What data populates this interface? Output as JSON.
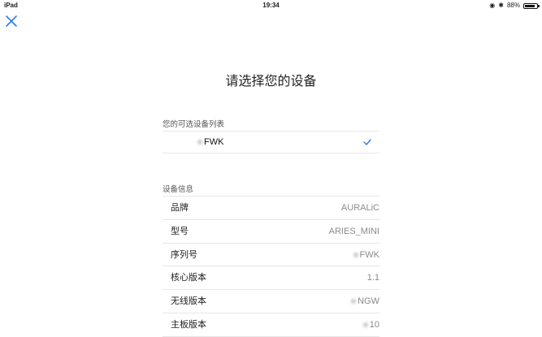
{
  "status_bar": {
    "device": "iPad",
    "time": "19:34",
    "battery_text": "88%",
    "battery_level": 0.88
  },
  "header": {
    "close_icon": "close-icon",
    "title": "请选择您的设备"
  },
  "device_list": {
    "section_label": "您的可选设备列表",
    "items": [
      {
        "name": "FWK",
        "selected": true
      }
    ]
  },
  "device_info": {
    "section_label": "设备信息",
    "rows": [
      {
        "label": "品牌",
        "value": "AURALiC"
      },
      {
        "label": "型号",
        "value": "ARIES_MINI"
      },
      {
        "label": "序列号",
        "value": "FWK"
      },
      {
        "label": "核心版本",
        "value": "1.1"
      },
      {
        "label": "无线版本",
        "value": "NGW"
      },
      {
        "label": "主板版本",
        "value": "10"
      }
    ]
  },
  "colors": {
    "accent": "#2b7de9",
    "text": "#222222",
    "secondary_text": "#8a8a8a",
    "divider": "#e6e6e6"
  }
}
